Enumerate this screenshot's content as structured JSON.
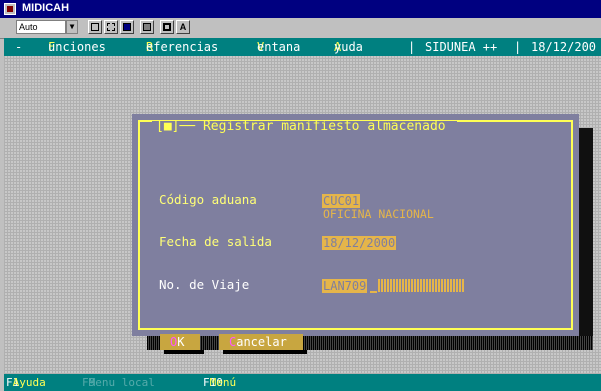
{
  "window": {
    "title": "MIDICAH"
  },
  "toolbar": {
    "font_value": "Auto",
    "buttons": [
      {
        "name": "copy-icon"
      },
      {
        "name": "paste-icon"
      },
      {
        "name": "fullscreen-icon"
      },
      {
        "name": "background-icon"
      },
      {
        "name": "properties-icon"
      },
      {
        "name": "font-icon",
        "label": "A"
      }
    ]
  },
  "menu": {
    "system": "-",
    "items": [
      {
        "hot": "F",
        "rest": "unciones"
      },
      {
        "hot": "R",
        "rest": "eferencias"
      },
      {
        "hot": "V",
        "rest": "entana"
      },
      {
        "hot": "A",
        "rest": "yuda"
      }
    ],
    "app_name": "SIDUNEA ++",
    "date_partial": "18/12/200"
  },
  "dialog": {
    "close_box": "[■]",
    "title": "Registrar manifiesto almacenado",
    "fields": {
      "codigo_aduana_label": "Código aduana",
      "codigo_aduana_value": "CUC01",
      "codigo_aduana_desc": "OFICINA NACIONAL",
      "fecha_label": "Fecha de salida",
      "fecha_value": "18/12/2000",
      "viaje_label": "No. de Viaje",
      "viaje_value": "LAN709"
    },
    "buttons": {
      "ok_hot": "O",
      "ok_rest": "K",
      "cancel_hot": "C",
      "cancel_rest": "ancelar"
    }
  },
  "statusbar": [
    {
      "key": "F1",
      "label": "Ayuda",
      "enabled": true
    },
    {
      "key": "F9",
      "label": "Menu local",
      "enabled": false
    },
    {
      "key": "F10",
      "label": "Menú",
      "enabled": true
    }
  ],
  "colors": {
    "menubar": "#008080",
    "dialog_bg": "#7f7f9f",
    "frame": "#ffff55",
    "field": "#e5b54a",
    "button": "#c8a640"
  }
}
